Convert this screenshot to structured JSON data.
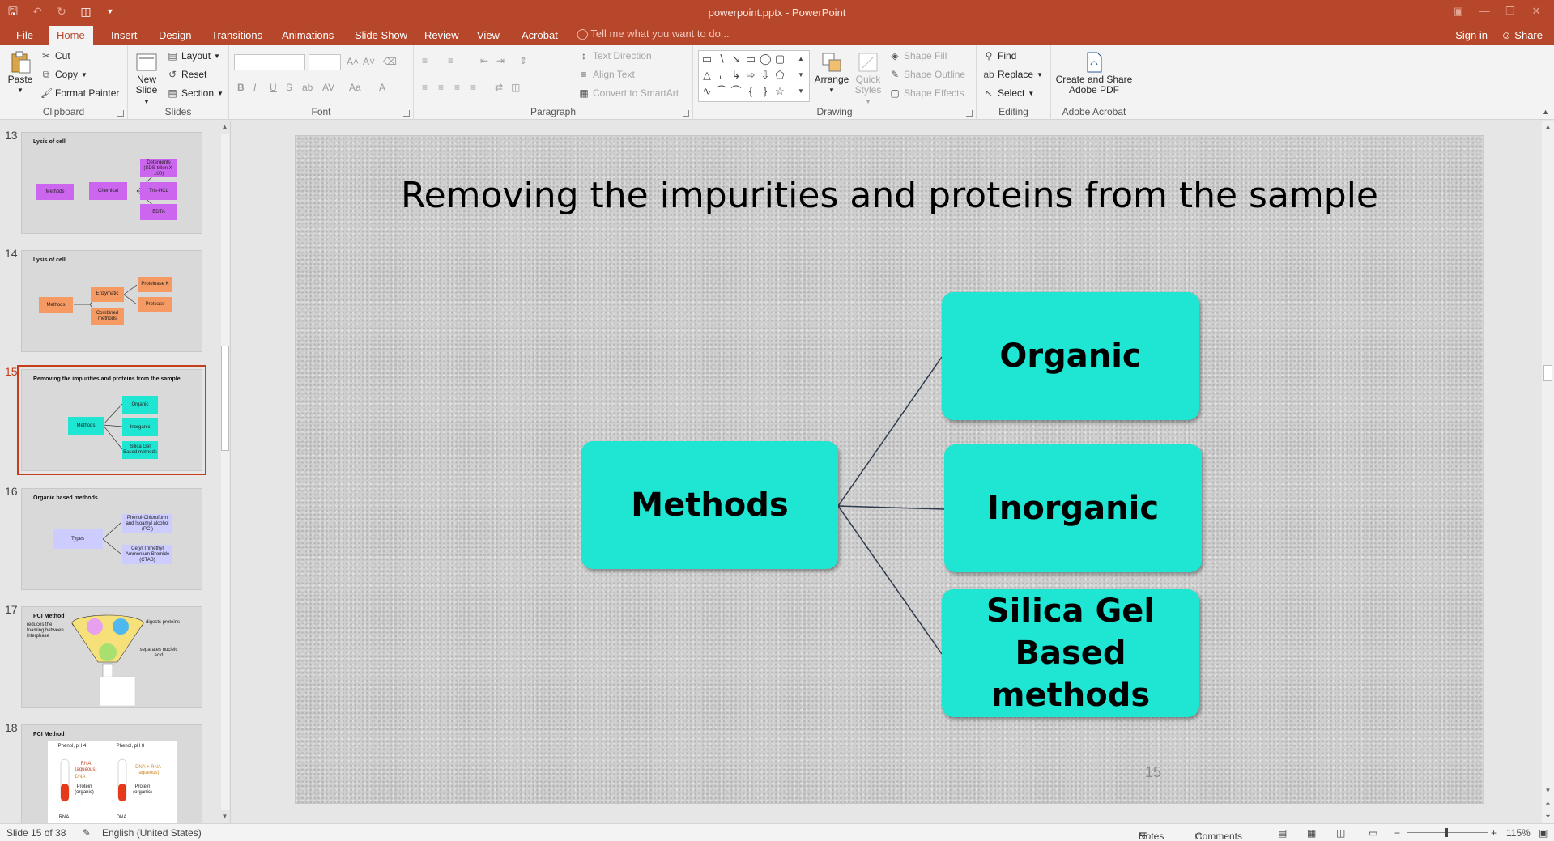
{
  "window": {
    "title": "powerpoint.pptx - PowerPoint"
  },
  "tabs": [
    {
      "label": "File"
    },
    {
      "label": "Home"
    },
    {
      "label": "Insert"
    },
    {
      "label": "Design"
    },
    {
      "label": "Transitions"
    },
    {
      "label": "Animations"
    },
    {
      "label": "Slide Show"
    },
    {
      "label": "Review"
    },
    {
      "label": "View"
    },
    {
      "label": "Acrobat"
    }
  ],
  "tell_me": "Tell me what you want to do...",
  "account": {
    "sign_in": "Sign in",
    "share": "Share"
  },
  "ribbon": {
    "clipboard": {
      "label": "Clipboard",
      "paste": "Paste",
      "cut": "Cut",
      "copy": "Copy",
      "format_painter": "Format Painter"
    },
    "slides": {
      "label": "Slides",
      "new_slide_1": "New",
      "new_slide_2": "Slide",
      "layout": "Layout",
      "reset": "Reset",
      "section": "Section"
    },
    "font": {
      "label": "Font"
    },
    "paragraph": {
      "label": "Paragraph",
      "text_direction": "Text Direction",
      "align_text": "Align Text",
      "convert_smartart": "Convert to SmartArt"
    },
    "drawing": {
      "label": "Drawing",
      "arrange": "Arrange",
      "quick_styles_1": "Quick",
      "quick_styles_2": "Styles",
      "shape_fill": "Shape Fill",
      "shape_outline": "Shape Outline",
      "shape_effects": "Shape Effects"
    },
    "editing": {
      "label": "Editing",
      "find": "Find",
      "replace": "Replace",
      "select": "Select"
    },
    "acrobat": {
      "label": "Adobe Acrobat",
      "create_1": "Create and Share",
      "create_2": "Adobe PDF"
    }
  },
  "thumbnails": [
    {
      "number": "13",
      "title": "Lysis of cell",
      "boxes": [
        "Methods",
        "Chemical",
        "Detergents (SDS-triton X-100)",
        "Tris-HCL",
        "EDTA"
      ]
    },
    {
      "number": "14",
      "title": "Lysis of cell",
      "boxes": [
        "Methods",
        "Enzymatic",
        "Combined methods",
        "Proteinase K",
        "Protease"
      ]
    },
    {
      "number": "15",
      "title": "Removing the impurities and proteins from the sample",
      "boxes": [
        "Methods",
        "Organic",
        "Inorganic",
        "Silica Gel Based methods"
      ]
    },
    {
      "number": "16",
      "title": "Organic based methods",
      "boxes": [
        "Types",
        "Phenol-Chloroform and Isoamyl alcohol (PCI)",
        "Cetyl Trimethyl Ammonium Bromide (CTAB)"
      ]
    },
    {
      "number": "17",
      "title": "PCI Method",
      "labels": [
        "reduces the foaming between interphase",
        "digests proteins",
        "separates nucleic acid"
      ]
    },
    {
      "number": "18",
      "title": "PCI Method",
      "labels": [
        "Phenol, pH 4",
        "Phenol, pH 8",
        "RNA (aqueous)",
        "DNA",
        "Protein (organic)",
        "DNA + RNA (aqueous)",
        "Protein (organic)",
        "RNA",
        "DNA"
      ]
    }
  ],
  "slide": {
    "title": "Removing the impurities and proteins from the sample",
    "root": "Methods",
    "children": [
      "Organic",
      "Inorganic",
      "Silica Gel Based methods"
    ],
    "children_lines": {
      "silica_1": "Silica Gel",
      "silica_2": "Based methods"
    },
    "number": "15",
    "box_color": "#1ee6d3"
  },
  "status": {
    "slide_info": "Slide 15 of 38",
    "language": "English (United States)",
    "notes": "Notes",
    "comments": "Comments",
    "zoom": "115%"
  },
  "colors": {
    "accent": "#b7472a",
    "selection": "#c43e1c"
  }
}
